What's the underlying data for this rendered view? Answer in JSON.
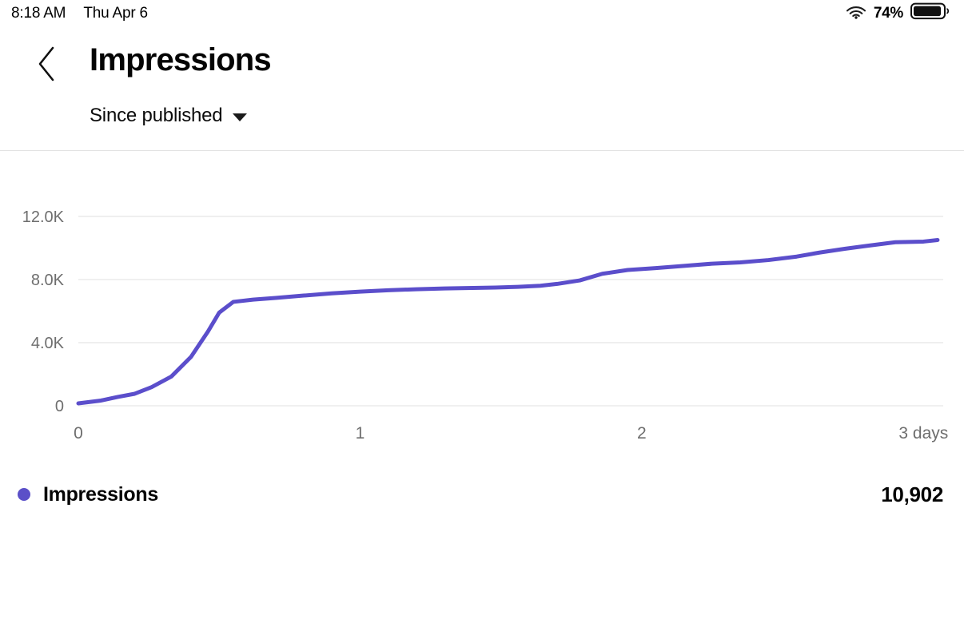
{
  "status_bar": {
    "time": "8:18 AM",
    "date": "Thu Apr 6",
    "battery_percent": "74%",
    "wifi_icon": "wifi-icon",
    "battery_icon": "battery-icon"
  },
  "header": {
    "back_icon": "chevron-left-icon",
    "title": "Impressions",
    "range": {
      "label": "Since published",
      "caret_icon": "triangle-down-icon"
    }
  },
  "legend": {
    "series_name": "Impressions",
    "total_value": "10,902",
    "dot_color": "#5b50c8"
  },
  "colors": {
    "line": "#5b4ecb",
    "grid": "#ebebeb",
    "divider": "#e3e3e3",
    "axis_text": "#6e6e6e",
    "background": "#ffffff"
  },
  "chart_data": {
    "type": "line",
    "title": "Impressions",
    "xlabel": "",
    "ylabel": "",
    "x_tick_labels": [
      "0",
      "1",
      "2",
      "3 days"
    ],
    "x_tick_values": [
      0,
      1,
      2,
      3
    ],
    "y_tick_labels": [
      "0",
      "4.0K",
      "8.0K",
      "12.0K"
    ],
    "y_tick_values": [
      0,
      4000,
      8000,
      12000
    ],
    "xlim": [
      0,
      3.07
    ],
    "ylim": [
      0,
      12800
    ],
    "grid": true,
    "legend_position": "below-chart",
    "series": [
      {
        "name": "Impressions",
        "color": "#5b4ecb",
        "total": 10902,
        "x": [
          0.0,
          0.08,
          0.14,
          0.2,
          0.26,
          0.33,
          0.4,
          0.46,
          0.5,
          0.55,
          0.62,
          0.7,
          0.8,
          0.9,
          1.0,
          1.1,
          1.2,
          1.3,
          1.4,
          1.48,
          1.56,
          1.64,
          1.7,
          1.78,
          1.86,
          1.95,
          2.05,
          2.15,
          2.25,
          2.35,
          2.45,
          2.55,
          2.63,
          2.72,
          2.8,
          2.9,
          3.0,
          3.05
        ],
        "y": [
          150,
          330,
          560,
          760,
          1180,
          1850,
          3100,
          4700,
          5900,
          6580,
          6720,
          6830,
          6980,
          7120,
          7230,
          7320,
          7380,
          7430,
          7460,
          7490,
          7530,
          7600,
          7720,
          7940,
          8360,
          8600,
          8720,
          8860,
          9000,
          9080,
          9230,
          9450,
          9700,
          9940,
          10130,
          10360,
          10400,
          10500
        ]
      }
    ]
  }
}
